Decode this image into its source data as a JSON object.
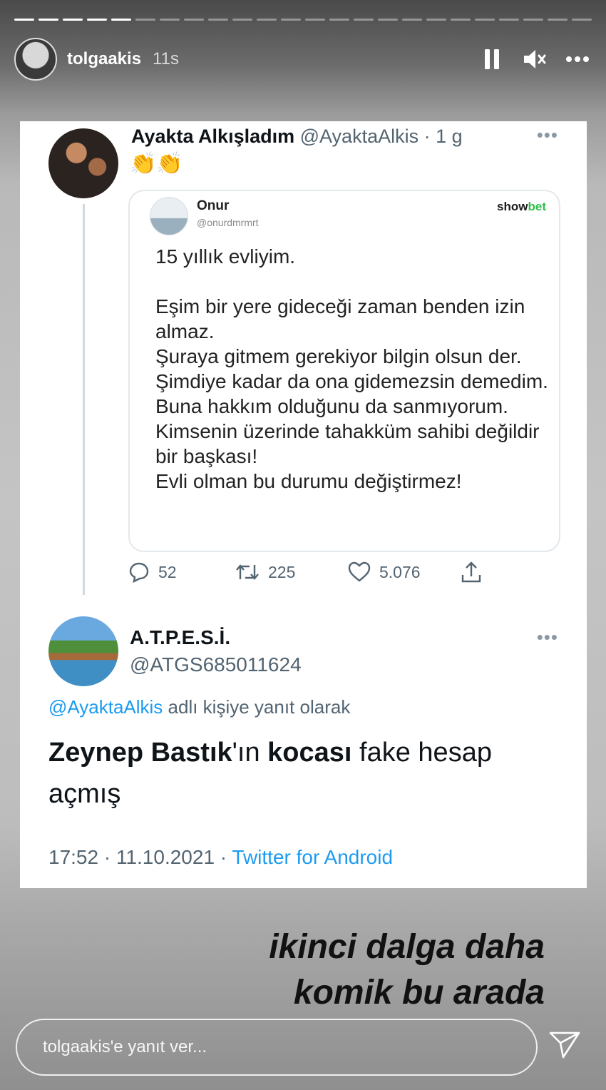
{
  "story": {
    "username": "tolgaakis",
    "time": "11s",
    "progress": {
      "total_segments": 24,
      "completed_segments": 5
    },
    "icons": [
      "pause-icon",
      "mute-icon",
      "more-icon"
    ]
  },
  "tweet1": {
    "name": "Ayakta Alkışladım",
    "handle": "@AyaktaAlkis",
    "separator": " · ",
    "time": "1 g",
    "emoji": "👏👏",
    "more": "•••",
    "quote": {
      "name": "Onur",
      "handle": "@onurdmrmrt",
      "brand_part1": "show",
      "brand_part2": "bet",
      "text": "15 yıllık evliyim.\n\nEşim bir yere gideceği zaman benden izin almaz.\nŞuraya gitmem gerekiyor bilgin olsun der.\nŞimdiye kadar da ona gidemezsin demedim. Buna hakkım olduğunu da sanmıyorum.\nKimsenin üzerinde tahakküm sahibi değildir bir başkası!\nEvli olman bu durumu değiştirmez!"
    },
    "actions": {
      "replies": "52",
      "retweets": "225",
      "likes": "5.076"
    }
  },
  "tweet2": {
    "name": "A.T.P.E.S.İ.",
    "handle": "@ATGS685011624",
    "more": "•••",
    "replying_mention": "@AyaktaAlkis",
    "replying_text": " adlı kişiye yanıt olarak",
    "body": {
      "bold1": "Zeynep Bastık",
      "plain1": "'ın ",
      "bold2": "kocası",
      "plain2": " fake hesap açmış"
    },
    "timestamp": "17:52 · 11.10.2021 · ",
    "source": "Twitter for Android"
  },
  "overlay": {
    "line1": "ikinci dalga daha",
    "line2": "komik bu arada"
  },
  "reply": {
    "placeholder": "tolgaakis'e yanıt ver..."
  },
  "colors": {
    "link": "#1d9bf0",
    "text": "#0f1419",
    "muted": "#536471",
    "brand_green": "#2fbf4a"
  }
}
